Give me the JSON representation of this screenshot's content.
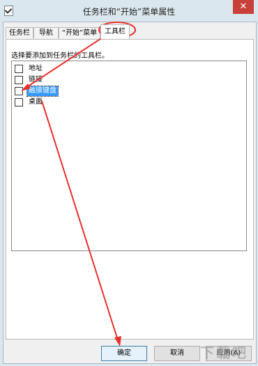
{
  "window": {
    "title": "任务栏和“开始”菜单属性",
    "close_glyph": "✕"
  },
  "tabs": [
    {
      "label": "任务栏"
    },
    {
      "label": "导航"
    },
    {
      "label": "“开始”菜单"
    },
    {
      "label": "工具栏",
      "active": true
    }
  ],
  "panel": {
    "instruction": "选择要添加到任务栏的工具栏。",
    "items": [
      {
        "label": "地址",
        "checked": false
      },
      {
        "label": "链接",
        "checked": false
      },
      {
        "label": "触摸键盘",
        "checked": false,
        "selected": true
      },
      {
        "label": "桌面",
        "checked": false
      }
    ]
  },
  "buttons": {
    "ok": "确定",
    "cancel": "取消",
    "apply": "应用(A)"
  },
  "watermark": "下载吧",
  "colors": {
    "selection": "#3399ff",
    "annotation": "#e8302a",
    "close_button": "#c7403a"
  }
}
